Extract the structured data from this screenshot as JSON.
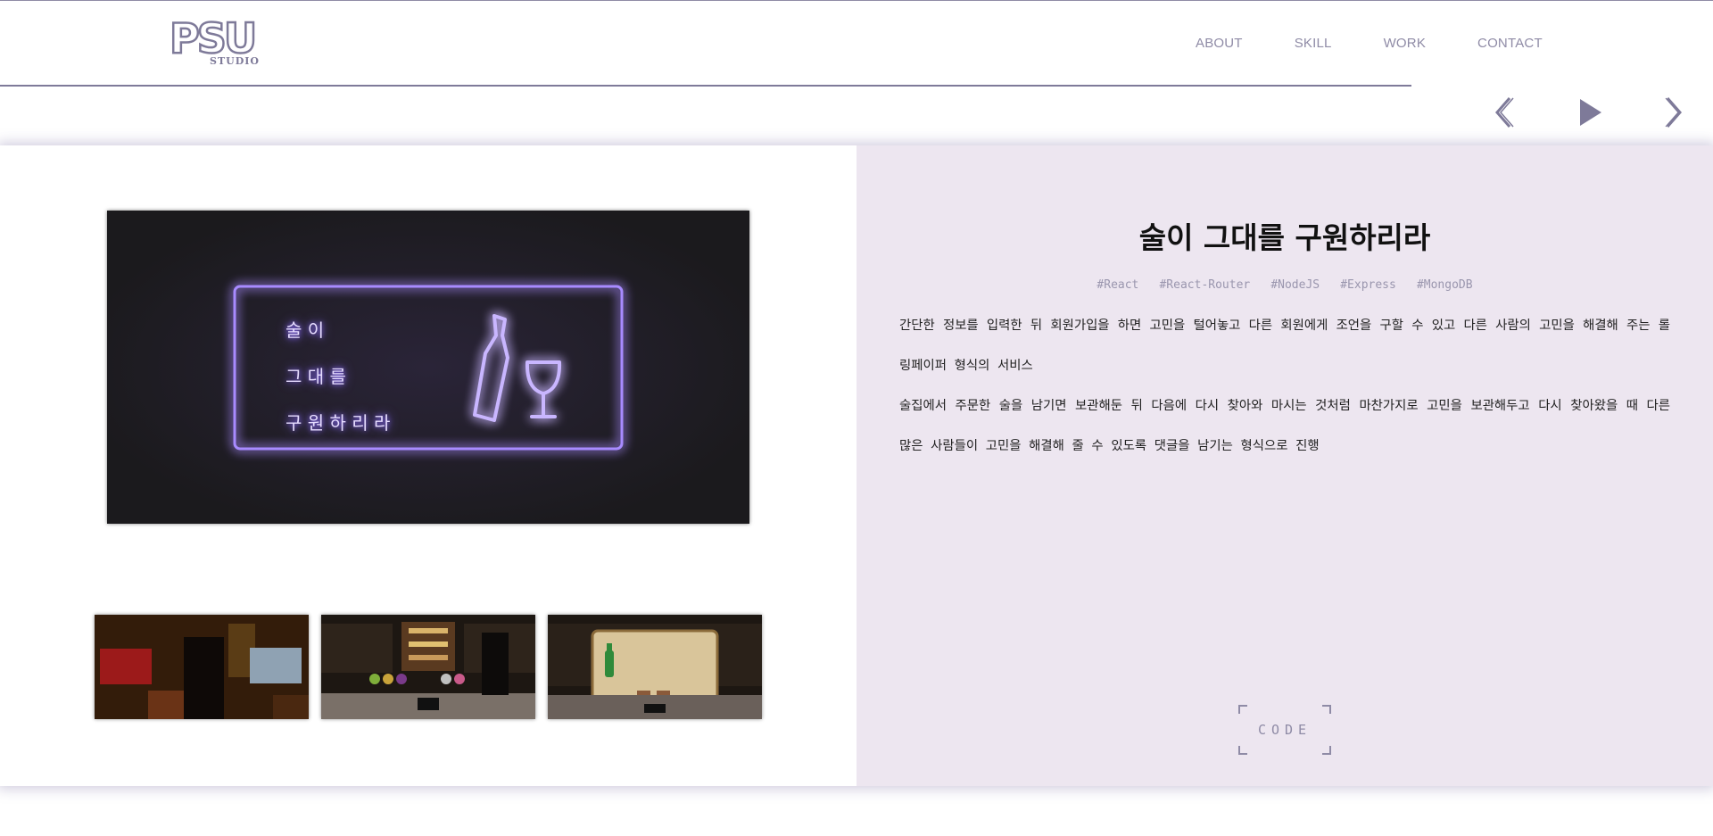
{
  "header": {
    "logo_text": "PSU",
    "logo_sub": "STUDIO",
    "nav": [
      {
        "label": "ABOUT"
      },
      {
        "label": "SKILL"
      },
      {
        "label": "WORK"
      },
      {
        "label": "CONTACT"
      }
    ]
  },
  "slider_controls": {
    "prev_icon": "chevron-left-icon",
    "play_icon": "play-icon",
    "next_icon": "chevron-right-icon"
  },
  "project": {
    "title": "술이 그대를 구원하리라",
    "tags": [
      "#React",
      "#React-Router",
      "#NodeJS",
      "#Express",
      "#MongoDB"
    ],
    "description": [
      "간단한 정보를 입력한 뒤 회원가입을 하면 고민을 털어놓고 다른 회원에게 조언을 구할 수 있고 다른 사람의 고민을 해결해 주는 롤링페이퍼 형식의 서비스",
      "술집에서 주문한 술을 남기면 보관해둔 뒤 다음에 다시 찾아와 마시는 것처럼 마찬가지로 고민을 보관해두고 다시 찾아왔을 때 다른 많은 사람들이 고민을 해결해 줄 수 있도록 댓글을 남기는 형식으로 진행"
    ],
    "hero_sign": [
      "술 이",
      "그 대 를",
      "구 원 하 리 라"
    ],
    "code_label": "CODE"
  },
  "colors": {
    "accent": "#7e7a99",
    "nav_text": "#8f8ba6",
    "right_panel_bg": "#ede6f0",
    "neon": "#8a6bff"
  }
}
